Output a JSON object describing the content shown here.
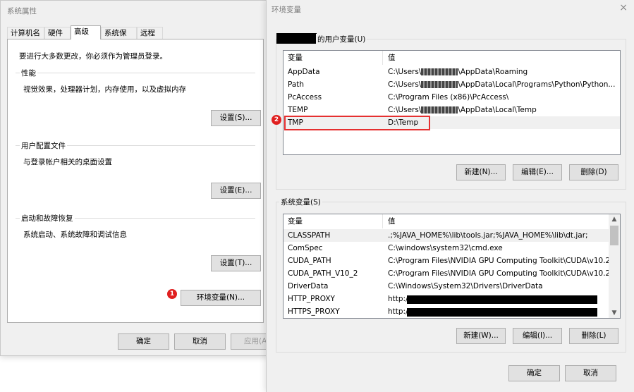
{
  "system_properties": {
    "title": "系统属性",
    "tabs": [
      "计算机名",
      "硬件",
      "高级",
      "系统保护",
      "远程"
    ],
    "active_tab": 2,
    "notice": "要进行大多数更改，你必须作为管理员登录。",
    "performance": {
      "legend": "性能",
      "desc": "视觉效果，处理器计划，内存使用，以及虚拟内存",
      "button": "设置(S)..."
    },
    "profile": {
      "legend": "用户配置文件",
      "desc": "与登录帐户相关的桌面设置",
      "button": "设置(E)..."
    },
    "startup": {
      "legend": "启动和故障恢复",
      "desc": "系统启动、系统故障和调试信息",
      "button": "设置(T)..."
    },
    "env_button": "环境变量(N)...",
    "badge_1": "1",
    "footer": {
      "ok": "确定",
      "cancel": "取消",
      "apply": "应用(A)"
    }
  },
  "env_vars": {
    "title": "环境变量",
    "close_glyph": "×",
    "user_section": {
      "legend": "的用户变量(U)",
      "col_var": "变量",
      "col_val": "值",
      "rows": [
        {
          "name": "AppData",
          "pre": "C:\\Users\\",
          "post": "\\AppData\\Roaming"
        },
        {
          "name": "Path",
          "pre": "C:\\Users\\",
          "post": "\\AppData\\Local\\Programs\\Python\\Python..."
        },
        {
          "name": "PcAccess",
          "pre": "C:\\Program Files (x86)\\PcAccess\\",
          "post": ""
        },
        {
          "name": "TEMP",
          "pre": "C:\\Users\\",
          "post": "\\AppData\\Local\\Temp"
        },
        {
          "name": "TMP",
          "pre": "D:\\Temp",
          "post": ""
        }
      ],
      "buttons": {
        "new": "新建(N)...",
        "edit": "编辑(E)...",
        "delete": "删除(D)"
      }
    },
    "badge_2": "2",
    "system_section": {
      "legend": "系统变量(S)",
      "col_var": "变量",
      "col_val": "值",
      "rows": [
        {
          "name": "CLASSPATH",
          "value": ".;%JAVA_HOME%\\lib\\tools.jar;%JAVA_HOME%\\lib\\dt.jar;"
        },
        {
          "name": "ComSpec",
          "value": "C:\\windows\\system32\\cmd.exe"
        },
        {
          "name": "CUDA_PATH",
          "value": "C:\\Program Files\\NVIDIA GPU Computing Toolkit\\CUDA\\v10.2"
        },
        {
          "name": "CUDA_PATH_V10_2",
          "value": "C:\\Program Files\\NVIDIA GPU Computing Toolkit\\CUDA\\v10.2"
        },
        {
          "name": "DriverData",
          "value": "C:\\Windows\\System32\\Drivers\\DriverData"
        },
        {
          "name": "HTTP_PROXY",
          "value": "http:/"
        },
        {
          "name": "HTTPS_PROXY",
          "value": "http:/"
        }
      ],
      "buttons": {
        "new": "新建(W)...",
        "edit": "编辑(I)...",
        "delete": "删除(L)"
      }
    },
    "footer": {
      "ok": "确定",
      "cancel": "取消"
    }
  }
}
